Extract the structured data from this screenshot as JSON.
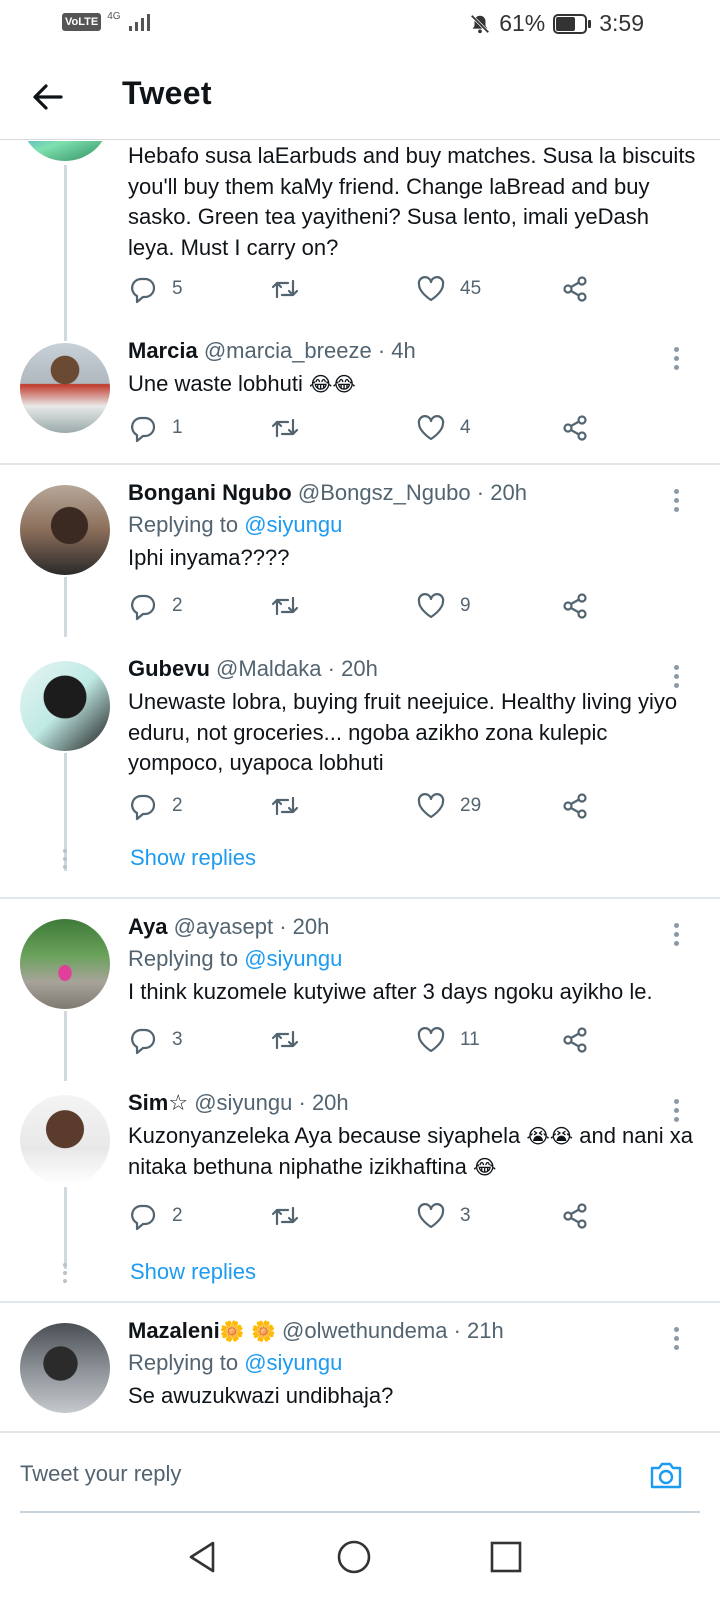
{
  "status_bar": {
    "volte": "VoLTE",
    "network": "4G",
    "battery_percent": "61%",
    "battery_level": 0.61,
    "time": "3:59"
  },
  "topbar": {
    "title": "Tweet"
  },
  "tweets": [
    {
      "body": "Hebafo susa laEarbuds and buy matches. Susa la biscuits you'll buy them kaMy friend. Change laBread and buy sasko. Green tea yayitheni? Susa lento, imali yeDash leya. Must I carry on?",
      "replies": "5",
      "likes": "45"
    },
    {
      "name": "Marcia",
      "handle": "@marcia_breeze",
      "time": "· 4h",
      "body": "Une waste lobhuti",
      "emoji": "😂😂",
      "replies": "1",
      "likes": "4"
    },
    {
      "name": "Bongani Ngubo",
      "handle": "@Bongsz_Ngubo",
      "time": "· 20h",
      "replying_prefix": "Replying to",
      "replying_to": "@siyungu",
      "body": "Iphi inyama????",
      "replies": "2",
      "likes": "9"
    },
    {
      "name": "Gubevu",
      "handle": "@Maldaka",
      "time": "· 20h",
      "body": "Unewaste lobra, buying fruit neejuice. Healthy living yiyo eduru, not groceries... ngoba azikho zona kulepic yompoco, uyapoca lobhuti",
      "replies": "2",
      "likes": "29",
      "show_replies": "Show replies"
    },
    {
      "name": "Aya",
      "handle": "@ayasept",
      "time": "· 20h",
      "replying_prefix": "Replying to",
      "replying_to": "@siyungu",
      "body": "I think kuzomele kutyiwe after 3 days ngoku ayikho le.",
      "replies": "3",
      "likes": "11"
    },
    {
      "name": "Sim☆",
      "handle": "@siyungu",
      "time": "· 20h",
      "body_part1": "Kuzonyanzeleka Aya because siyaphela",
      "emoji1": "😭😭",
      "body_part2": "and nani xa nitaka bethuna niphathe izikhaftina",
      "emoji2": "😂",
      "replies": "2",
      "likes": "3",
      "show_replies": "Show replies"
    },
    {
      "name": "Mazaleni",
      "name_emoji": "🌼 🌼",
      "handle": "@olwethundema",
      "time": "· 21h",
      "replying_prefix": "Replying to",
      "replying_to": "@siyungu",
      "body": "Se awuzukwazi undibhaja?"
    }
  ],
  "reply_bar": {
    "placeholder": "Tweet your reply"
  },
  "icons": {
    "reply": "reply-icon",
    "retweet": "retweet-icon",
    "like": "heart-icon",
    "share": "share-icon",
    "back": "back-arrow-icon",
    "camera": "camera-icon"
  },
  "colors": {
    "accent": "#1d9bf0",
    "text": "#0f1419",
    "muted": "#536471"
  }
}
